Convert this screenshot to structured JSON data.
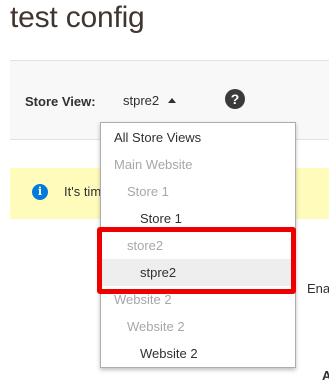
{
  "page": {
    "title": "test config"
  },
  "scope": {
    "label": "Store View:",
    "current": "stpre2",
    "help_icon": "question-icon"
  },
  "notice": {
    "icon": "info-icon",
    "text": "It's tim"
  },
  "background_text": {
    "partial_1": "Ena",
    "partial_2": "A"
  },
  "dropdown": {
    "items": [
      {
        "label": "All Store Views",
        "level": 0,
        "enabled": true
      },
      {
        "label": "Main Website",
        "level": 0,
        "enabled": false
      },
      {
        "label": "Store 1",
        "level": 1,
        "enabled": false
      },
      {
        "label": "Store 1",
        "level": 2,
        "enabled": true
      },
      {
        "label": "store2",
        "level": 1,
        "enabled": false
      },
      {
        "label": "stpre2",
        "level": 2,
        "enabled": true,
        "selected": true
      },
      {
        "label": "Website 2",
        "level": 0,
        "enabled": false
      },
      {
        "label": "Website 2",
        "level": 1,
        "enabled": false
      },
      {
        "label": "Website 2",
        "level": 2,
        "enabled": true
      }
    ]
  },
  "colors": {
    "highlight": "#ee0000",
    "notice_bg": "#fffbbb",
    "info_blue": "#007bdb"
  }
}
